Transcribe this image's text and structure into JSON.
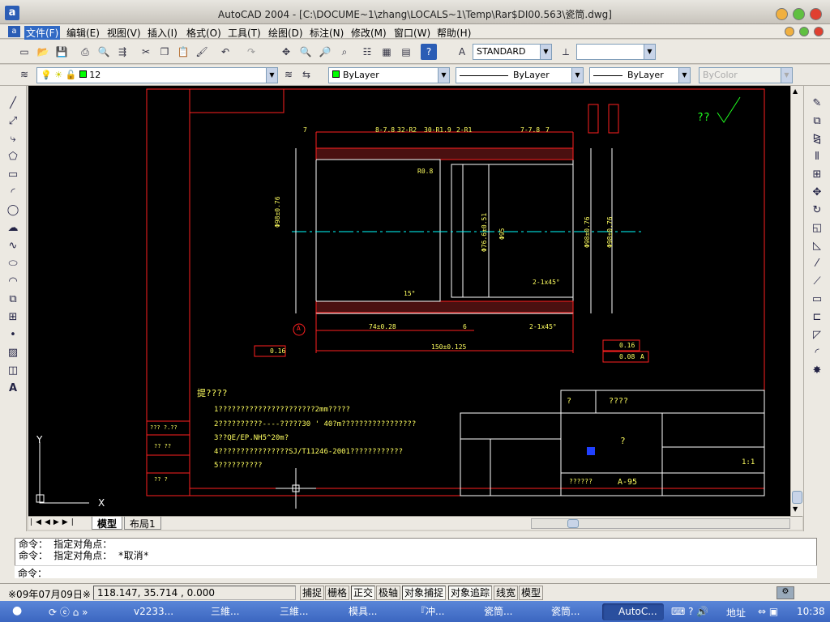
{
  "window": {
    "title": "AutoCAD 2004 - [C:\\DOCUME~1\\zhang\\LOCALS~1\\Temp\\Rar$DI00.563\\瓷筒.dwg]"
  },
  "menu": [
    "文件(F)",
    "编辑(E)",
    "视图(V)",
    "插入(I)",
    "格式(O)",
    "工具(T)",
    "绘图(D)",
    "标注(N)",
    "修改(M)",
    "窗口(W)",
    "帮助(H)"
  ],
  "toolbar": {
    "text_style": "STANDARD",
    "dim_style": ""
  },
  "layer_bar": {
    "layer_name": "12",
    "color": "ByLayer",
    "linetype": "ByLayer",
    "lineweight": "ByLayer",
    "plotstyle": "ByColor"
  },
  "drawing": {
    "dim_top": [
      "7",
      "8-7.8",
      "32-R2",
      "30-R1.9",
      "2-R1",
      "7-7.8",
      "7"
    ],
    "dim_bottom_left": "74±0.28",
    "dim_bottom_mid": "6",
    "dim_total": "150±0.125",
    "chamfer1": "2-1x45°",
    "chamfer2": "2-1x45°",
    "radius_label": "R0.8",
    "angle_label": "15°",
    "datum": "A",
    "flatness_left": "0.16",
    "flatness_right": "0.16",
    "parallel_tol": "0.08",
    "parallel_ref": "A",
    "dia_left": "Φ98±0.76",
    "dia_mid1": "Φ76.6±0.51",
    "dia_mid2": "Φ95",
    "dia_right1": "Φ98±0.76",
    "dia_right2": "Φ98±0.76",
    "top_right_sym": "??",
    "notes_title": "提????",
    "notes": [
      "1??????????????????????2mm?????",
      "2??????????----?????30 ' 40?m?????????????????",
      "3??QE/EP.NH5^20m?",
      "4????????????????SJ/T11246-2001????????????",
      "5??????????"
    ],
    "title_block": {
      "part_label": "?",
      "material_label": "????",
      "drawing_no": "A-95",
      "product_name": "??????",
      "scale": "1:1",
      "small_labels": [
        "??",
        "??",
        "?",
        "?",
        "?",
        "?"
      ]
    },
    "left_table": [
      "??? ?.??",
      "?? ??",
      "?? ?"
    ],
    "ucs": {
      "x": "X",
      "y": "Y"
    }
  },
  "tabs": [
    "模型",
    "布局1"
  ],
  "command": {
    "history": [
      "命令： 指定对角点：",
      "命令： 指定对角点： *取消*"
    ],
    "prompt": "命令："
  },
  "status": {
    "date": "※09年07月09日※",
    "coords": "118.147, 35.714 , 0.000",
    "toggles": [
      "捕捉",
      "栅格",
      "正交",
      "极轴",
      "对象捕捉",
      "对象追踪",
      "线宽",
      "模型"
    ],
    "on_toggles": [
      "正交",
      "对象捕捉",
      "对象追踪"
    ]
  },
  "taskbar": {
    "items": [
      "v2233...",
      "三維...",
      "三維...",
      "模具...",
      "『冲...",
      "瓷筒...",
      "瓷筒...",
      "AutoC..."
    ],
    "active": "AutoC...",
    "address_label": "地址",
    "clock": "10:38"
  },
  "colors": {
    "canvas": "#000000",
    "red": "#ff2020",
    "green": "#20ff20",
    "cyan": "#00ffff",
    "yellow": "#ffff00"
  }
}
